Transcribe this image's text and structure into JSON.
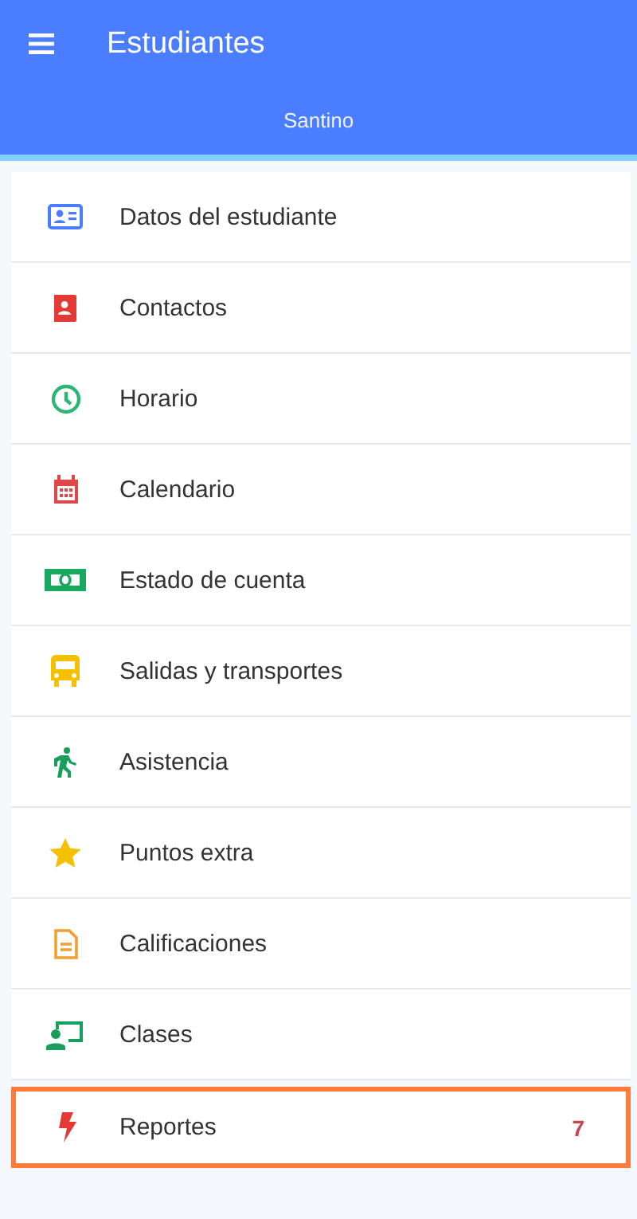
{
  "app_bar": {
    "title": "Estudiantes",
    "subtitle": "Santino"
  },
  "menu_items": [
    {
      "label": "Datos del estudiante",
      "color": "#4a7dff",
      "highlighted": false
    },
    {
      "label": "Contactos",
      "color": "#e53935",
      "highlighted": false
    },
    {
      "label": "Horario",
      "color": "#2bb673",
      "highlighted": false
    },
    {
      "label": "Calendario",
      "color": "#e04848",
      "highlighted": false
    },
    {
      "label": "Estado de cuenta",
      "color": "#1aa760",
      "highlighted": false
    },
    {
      "label": "Salidas y transportes",
      "color": "#f5c000",
      "highlighted": false
    },
    {
      "label": "Asistencia",
      "color": "#1a9e5c",
      "highlighted": false
    },
    {
      "label": "Puntos extra",
      "color": "#f5c000",
      "highlighted": false
    },
    {
      "label": "Calificaciones",
      "color": "#f0a030",
      "highlighted": false
    },
    {
      "label": "Clases",
      "color": "#1a9e5c",
      "highlighted": false
    },
    {
      "label": "Reportes",
      "color": "#e53935",
      "highlighted": true,
      "count": "7"
    }
  ]
}
